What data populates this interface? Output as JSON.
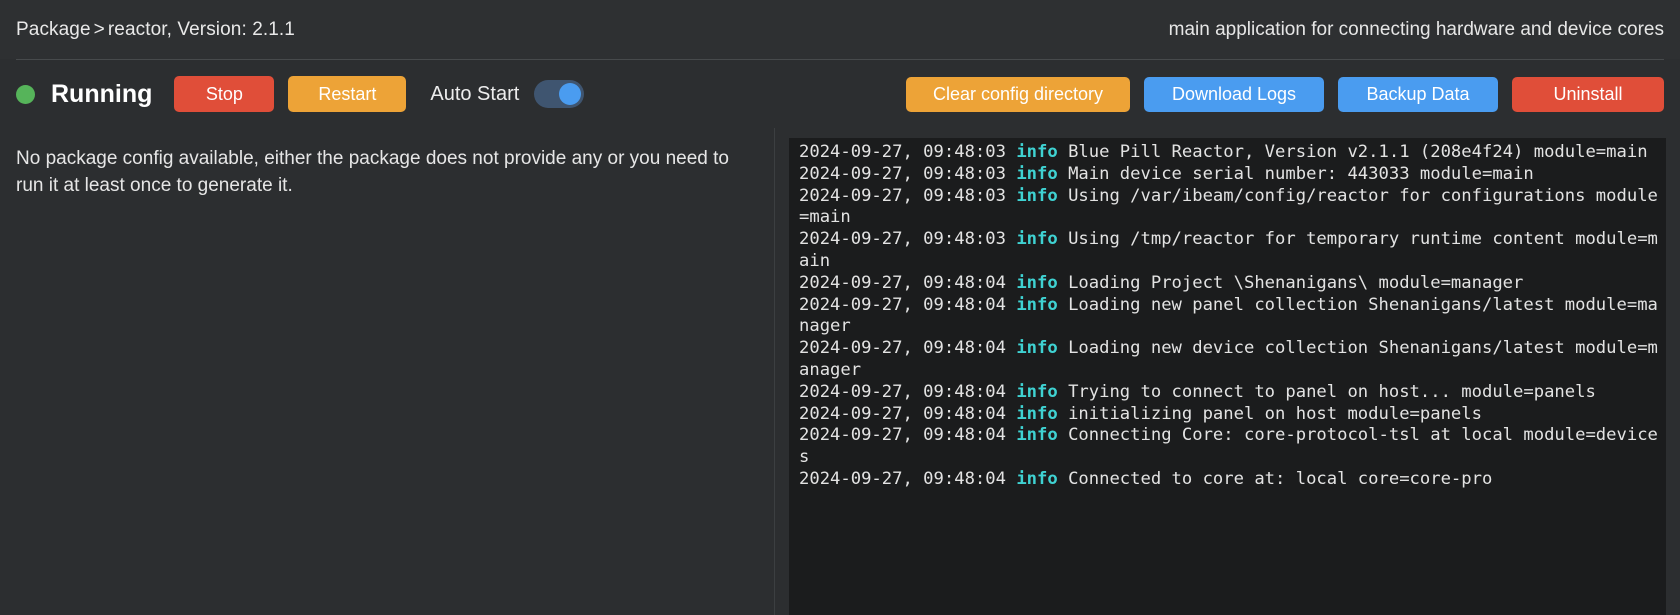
{
  "header": {
    "breadcrumb_root": "Package",
    "breadcrumb_separator": ">",
    "breadcrumb_current": "reactor, Version: 2.1.1",
    "description": "main application for connecting hardware and device cores"
  },
  "toolbar": {
    "status_label": "Running",
    "status_color": "#56b45a",
    "stop_label": "Stop",
    "restart_label": "Restart",
    "autostart_label": "Auto Start",
    "autostart_on": true,
    "clear_config_label": "Clear config directory",
    "download_logs_label": "Download Logs",
    "backup_data_label": "Backup Data",
    "uninstall_label": "Uninstall",
    "highlight_color": "#ef3b21"
  },
  "config_pane": {
    "message": "No package config available, either the package does not provide any or you need to run it at least once to generate it."
  },
  "log_pane": {
    "level_color": "#3fd2d2",
    "lines": [
      {
        "timestamp": "2024-09-27, 09:48:03",
        "level": "info",
        "message": "Blue Pill Reactor, Version v2.1.1 (208e4f24) module=main"
      },
      {
        "timestamp": "2024-09-27, 09:48:03",
        "level": "info",
        "message": "Main device serial number: 443033 module=main"
      },
      {
        "timestamp": "2024-09-27, 09:48:03",
        "level": "info",
        "message": "Using /var/ibeam/config/reactor for configurations module=main"
      },
      {
        "timestamp": "2024-09-27, 09:48:03",
        "level": "info",
        "message": "Using /tmp/reactor for temporary runtime content module=main"
      },
      {
        "timestamp": "2024-09-27, 09:48:04",
        "level": "info",
        "message": "Loading Project \\Shenanigans\\ module=manager"
      },
      {
        "timestamp": "2024-09-27, 09:48:04",
        "level": "info",
        "message": "Loading new panel collection Shenanigans/latest module=manager"
      },
      {
        "timestamp": "2024-09-27, 09:48:04",
        "level": "info",
        "message": "Loading new device collection Shenanigans/latest module=manager"
      },
      {
        "timestamp": "2024-09-27, 09:48:04",
        "level": "info",
        "message": "Trying to connect to panel on host... module=panels"
      },
      {
        "timestamp": "2024-09-27, 09:48:04",
        "level": "info",
        "message": "initializing panel on host module=panels"
      },
      {
        "timestamp": "2024-09-27, 09:48:04",
        "level": "info",
        "message": "Connecting Core: core-protocol-tsl at local module=devices"
      },
      {
        "timestamp": "2024-09-27, 09:48:04",
        "level": "info",
        "message": "Connected to core at: local core=core-pro"
      }
    ]
  }
}
